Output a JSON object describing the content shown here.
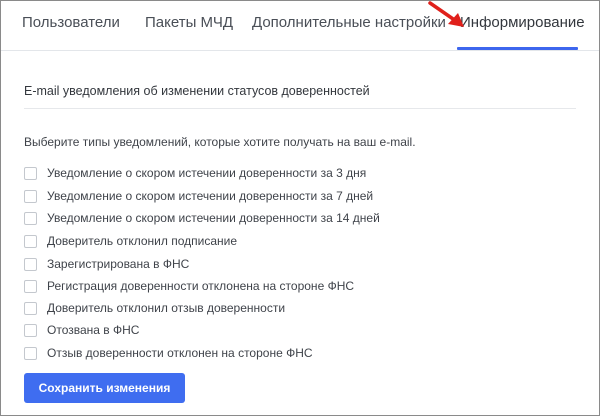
{
  "tabs": [
    {
      "label": "Пользователи",
      "active": false
    },
    {
      "label": "Пакеты МЧД",
      "active": false
    },
    {
      "label": "Дополнительные настройки",
      "active": false
    },
    {
      "label": "Информирование",
      "active": true
    }
  ],
  "accent_color": "#3d66ee",
  "annotation": {
    "icon": "red-arrow-icon",
    "color": "#e0201b"
  },
  "section": {
    "title": "E-mail уведомления об изменении статусов доверенностей",
    "intro": "Выберите типы уведомлений, которые хотите получать на ваш e-mail."
  },
  "options": [
    {
      "label": "Уведомление о скором истечении доверенности за 3 дня",
      "checked": false
    },
    {
      "label": "Уведомление о скором истечении доверенности за 7 дней",
      "checked": false
    },
    {
      "label": "Уведомление о скором истечении доверенности за 14 дней",
      "checked": false
    },
    {
      "label": "Доверитель отклонил подписание",
      "checked": false
    },
    {
      "label": "Зарегистрирована в ФНС",
      "checked": false
    },
    {
      "label": "Регистрация доверенности отклонена на стороне ФНС",
      "checked": false
    },
    {
      "label": "Доверитель отклонил отзыв доверенности",
      "checked": false
    },
    {
      "label": "Отозвана в ФНС",
      "checked": false
    },
    {
      "label": "Отзыв доверенности отклонен на стороне ФНС",
      "checked": false
    }
  ],
  "save_button": {
    "label": "Сохранить изменения",
    "color": "#3f6df0"
  }
}
